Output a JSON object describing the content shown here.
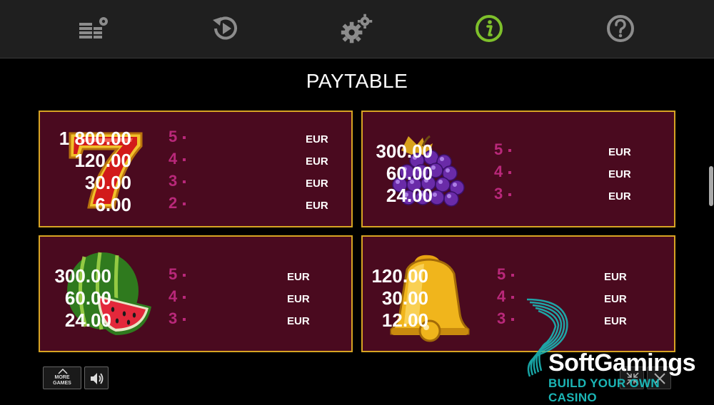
{
  "toolbar": {
    "icons": [
      "bet-settings-icon",
      "history-replay-icon",
      "settings-gears-icon",
      "info-icon",
      "help-icon"
    ],
    "active_color": "#7ec02b",
    "inactive_color": "#8c8c8c"
  },
  "title": "PAYTABLE",
  "panels": [
    {
      "symbol": "lucky-seven",
      "rows": [
        {
          "count": "5",
          "amount": "1 800.00",
          "currency": "EUR"
        },
        {
          "count": "4",
          "amount": "120.00",
          "currency": "EUR"
        },
        {
          "count": "3",
          "amount": "30.00",
          "currency": "EUR"
        },
        {
          "count": "2",
          "amount": "6.00",
          "currency": "EUR"
        }
      ]
    },
    {
      "symbol": "grapes",
      "rows": [
        {
          "count": "5",
          "amount": "300.00",
          "currency": "EUR"
        },
        {
          "count": "4",
          "amount": "60.00",
          "currency": "EUR"
        },
        {
          "count": "3",
          "amount": "24.00",
          "currency": "EUR"
        }
      ]
    },
    {
      "symbol": "watermelon",
      "rows": [
        {
          "count": "5",
          "amount": "300.00",
          "currency": "EUR"
        },
        {
          "count": "4",
          "amount": "60.00",
          "currency": "EUR"
        },
        {
          "count": "3",
          "amount": "24.00",
          "currency": "EUR"
        }
      ]
    },
    {
      "symbol": "bell",
      "rows": [
        {
          "count": "5",
          "amount": "120.00",
          "currency": "EUR"
        },
        {
          "count": "4",
          "amount": "30.00",
          "currency": "EUR"
        },
        {
          "count": "3",
          "amount": "12.00",
          "currency": "EUR"
        }
      ]
    }
  ],
  "bottom": {
    "more_games_line1": "MORE",
    "more_games_line2": "GAMES",
    "sound_icon": "speaker-icon",
    "fullscreen_icon": "collapse-icon",
    "close_icon": "close-icon"
  },
  "watermark": {
    "name": "SoftGamings",
    "tagline": "BUILD YOUR OWN CASINO"
  },
  "colors": {
    "panel_bg": "#4a0a1f",
    "panel_border": "#d7a423",
    "count_color": "#b9287a"
  }
}
